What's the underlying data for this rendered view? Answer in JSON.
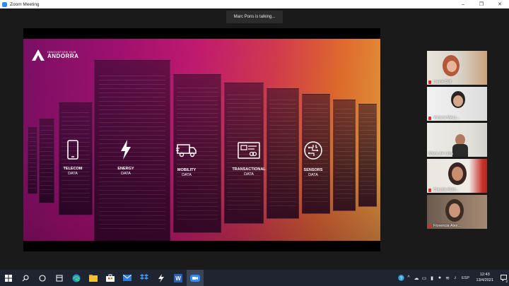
{
  "window": {
    "title": "Zoom Meeting",
    "controls": [
      "–",
      "❐",
      "✕"
    ]
  },
  "banner": {
    "talking": "Marc Pons is talking..."
  },
  "slide": {
    "logo_small": "INNOVATION HUB",
    "logo_big": "ANDORRA",
    "categories": [
      {
        "line1": "TELECOM",
        "line2": "DATA",
        "icon": "smartphone-icon"
      },
      {
        "line1": "ENERGY",
        "line2": "DATA",
        "icon": "lightning-icon"
      },
      {
        "line1": "MOBILITY",
        "line2": "DATA",
        "icon": "truck-icon"
      },
      {
        "line1": "TRANSACTIONAL",
        "line2": "DATA",
        "icon": "card-icon"
      },
      {
        "line1": "SENSORS",
        "line2": "DATA",
        "icon": "chip-icon"
      }
    ],
    "dot_colors": [
      "#3aa0e0",
      "#f2c230",
      "#e0472a"
    ]
  },
  "participants": [
    {
      "name": "Laura Coll"
    },
    {
      "name": "Viviana Mezz..."
    },
    {
      "name": "Maria de Lima"
    },
    {
      "name": "Claudia Roth..."
    },
    {
      "name": "Florencia Alex..."
    }
  ],
  "taskbar": {
    "apps": [
      "windows-start-icon",
      "search-icon",
      "task-view-icon",
      "widgets-icon",
      "edge-icon",
      "file-explorer-icon",
      "store-icon",
      "mail-icon",
      "dropbox-icon",
      "cursor-app-icon",
      "word-icon",
      "zoom-icon"
    ],
    "language": "ESP",
    "time": "12:43",
    "date": "13/4/2021",
    "notifications": "2"
  },
  "colors": {
    "zoom_blue": "#2d8cff",
    "mic_muted": "#e02828"
  }
}
